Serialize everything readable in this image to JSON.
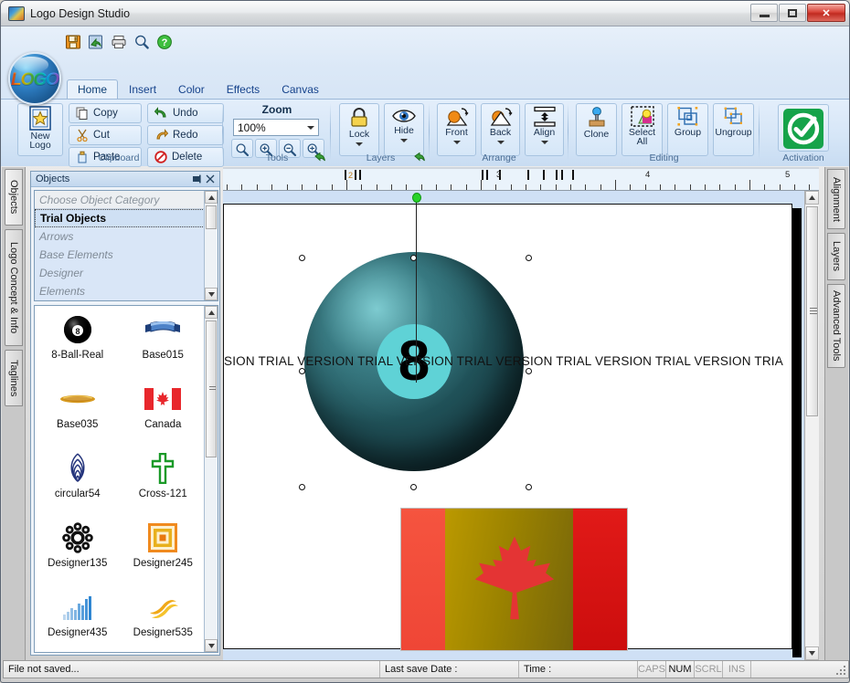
{
  "window": {
    "title": "Logo Design Studio",
    "app_icon": "app-logo-icon",
    "minimize_label": "Minimize",
    "maximize_label": "Maximize",
    "close_label": "✕"
  },
  "quick_access": [
    {
      "name": "save-icon",
      "label": "Save"
    },
    {
      "name": "save-as-icon",
      "label": "Save As"
    },
    {
      "name": "print-icon",
      "label": "Print"
    },
    {
      "name": "preview-icon",
      "label": "Print Preview"
    },
    {
      "name": "help-icon",
      "label": "Help"
    }
  ],
  "ribbon": {
    "tabs": [
      {
        "label": "Home",
        "active": true
      },
      {
        "label": "Insert",
        "active": false
      },
      {
        "label": "Color",
        "active": false
      },
      {
        "label": "Effects",
        "active": false
      },
      {
        "label": "Canvas",
        "active": false
      }
    ],
    "groups": {
      "clipboard": {
        "label": "Clipboard",
        "new_logo": "New\nLogo",
        "new_logo_line1": "New",
        "new_logo_line2": "Logo",
        "buttons": [
          "Copy",
          "Cut",
          "Paste",
          "Undo",
          "Redo",
          "Delete"
        ]
      },
      "tools": {
        "label": "Tools",
        "zoom_title": "Zoom",
        "zoom_value": "100%",
        "zoom_buttons": [
          "zoom-tool-icon",
          "zoom-in-icon",
          "zoom-out-icon",
          "zoom-fit-icon"
        ]
      },
      "layers": {
        "label": "Layers",
        "buttons": [
          "Lock",
          "Hide"
        ]
      },
      "arrange": {
        "label": "Arrange",
        "buttons": [
          "Front",
          "Back",
          "Align"
        ]
      },
      "editing": {
        "label": "Editing",
        "buttons": [
          "Clone",
          "Select All",
          "Group",
          "Ungroup"
        ],
        "select_all_line1": "Select",
        "select_all_line2": "All"
      },
      "activation": {
        "label": "Activation",
        "button": "activation-check-icon"
      }
    }
  },
  "left_tabs": [
    {
      "label": "Objects",
      "active": true
    },
    {
      "label": "Logo Concept & Info",
      "active": false
    },
    {
      "label": "Taglines",
      "active": false
    }
  ],
  "right_tabs": [
    {
      "label": "Alignment"
    },
    {
      "label": "Layers"
    },
    {
      "label": "Advanced Tools"
    }
  ],
  "objects_panel": {
    "title": "Objects",
    "pin_icon": "pin-icon",
    "close_icon": "close-icon",
    "categories": [
      {
        "label": "Choose Object Category",
        "state": "placeholder"
      },
      {
        "label": "Trial Objects",
        "state": "selected"
      },
      {
        "label": "Arrows",
        "state": "normal"
      },
      {
        "label": "Base Elements",
        "state": "normal"
      },
      {
        "label": "Designer",
        "state": "normal"
      },
      {
        "label": "Elements",
        "state": "normal"
      }
    ],
    "thumbnails": [
      {
        "name": "8-Ball-Real",
        "icon": "eight-ball-icon"
      },
      {
        "name": "Base015",
        "icon": "ribbon-banner-icon"
      },
      {
        "name": "Base035",
        "icon": "gold-swash-icon"
      },
      {
        "name": "Canada",
        "icon": "canada-flag-icon"
      },
      {
        "name": "circular54",
        "icon": "circular-waves-icon"
      },
      {
        "name": "Cross-121",
        "icon": "cross-icon"
      },
      {
        "name": "Designer135",
        "icon": "flower-rosette-icon"
      },
      {
        "name": "Designer245",
        "icon": "nested-squares-icon"
      },
      {
        "name": "Designer435",
        "icon": "bar-chart-icon"
      },
      {
        "name": "Designer535",
        "icon": "double-s-icon"
      }
    ]
  },
  "canvas": {
    "ruler_numbers": [
      "2",
      "3",
      "4",
      "5"
    ],
    "watermark_text": "SION   TRIAL VERSION   TRIAL VERSION   TRIAL VERSION   TRIAL VERSION   TRIAL VERSION   TRIA",
    "objects": [
      {
        "name": "8-Ball-Real",
        "label": "8",
        "selected": true
      },
      {
        "name": "Canada",
        "label": "",
        "selected": false
      }
    ],
    "eight_ball_number": "8"
  },
  "status_bar": {
    "file_status": "File not saved...",
    "last_save_label": "Last save Date :",
    "time_label": "Time :",
    "indicators": [
      {
        "label": "CAPS",
        "on": false
      },
      {
        "label": "NUM",
        "on": true
      },
      {
        "label": "SCRL",
        "on": false
      },
      {
        "label": "INS",
        "on": false
      }
    ]
  },
  "colors": {
    "accent": "#15428b",
    "ribbon_bg": "#d6e6f7",
    "activation_green": "#16a34a",
    "ball_teal": "#5fd2d6",
    "flag_red": "#e02020"
  }
}
